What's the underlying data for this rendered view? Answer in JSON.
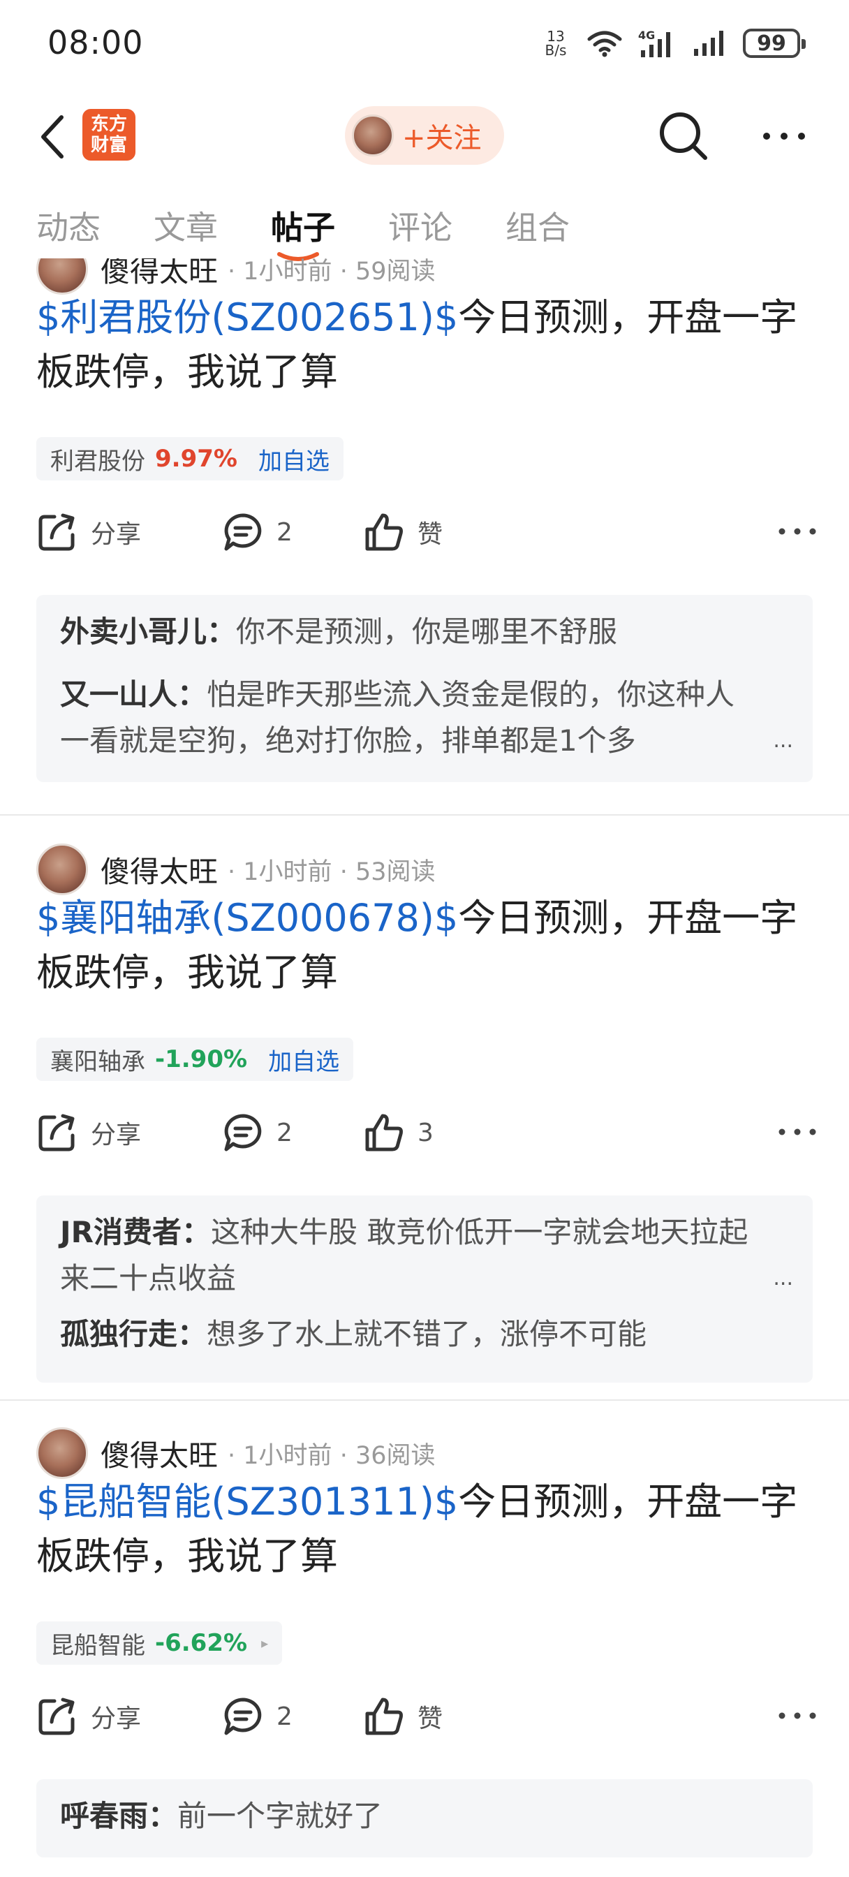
{
  "status_bar": {
    "time": "08:00",
    "net_speed_value": "13",
    "net_speed_unit": "B/s",
    "battery": "99"
  },
  "header": {
    "logo_line1": "东方",
    "logo_line2": "财富",
    "follow_label": "+关注"
  },
  "tabs": [
    {
      "label": "动态"
    },
    {
      "label": "文章"
    },
    {
      "label": "帖子"
    },
    {
      "label": "评论"
    },
    {
      "label": "组合"
    }
  ],
  "active_tab": "帖子",
  "colors": {
    "brand": "#ec5a2a",
    "link": "#1a64c8",
    "up": "#e0452d",
    "down": "#21a35a"
  },
  "posts": [
    {
      "author": "傻得太旺",
      "time": "1小时前",
      "reads": "59阅读",
      "stock_link": "$利君股份(SZ002651)$",
      "title_rest": "今日预测，开盘一字板跌停，我说了算",
      "chip": {
        "name": "利君股份",
        "change": "9.97%",
        "add": "加自选"
      },
      "actions": {
        "share": "分享",
        "comments": "2",
        "like": "赞"
      },
      "comments": [
        {
          "author": "外卖小哥儿：",
          "text": "你不是预测，你是哪里不舒服"
        },
        {
          "author": "又一山人：",
          "text": "怕是昨天那些流入资金是假的，你这种人一看就是空狗，绝对打你脸，排单都是1个多",
          "ellipsis": "..."
        }
      ]
    },
    {
      "author": "傻得太旺",
      "time": "1小时前",
      "reads": "53阅读",
      "stock_link": "$襄阳轴承(SZ000678)$",
      "title_rest": "今日预测，开盘一字板跌停，我说了算",
      "chip": {
        "name": "襄阳轴承",
        "change": "-1.90%",
        "add": "加自选"
      },
      "actions": {
        "share": "分享",
        "comments": "2",
        "like": "3"
      },
      "comments": [
        {
          "author": "JR消费者：",
          "text": "这种大牛股 敢竞价低开一字就会地天拉起来二十点收益",
          "ellipsis": "..."
        },
        {
          "author": "孤独行走：",
          "text": "想多了水上就不错了，涨停不可能"
        }
      ]
    },
    {
      "author": "傻得太旺",
      "time": "1小时前",
      "reads": "36阅读",
      "stock_link": "$昆船智能(SZ301311)$",
      "title_rest": "今日预测，开盘一字板跌停，我说了算",
      "chip": {
        "name": "昆船智能",
        "change": "-6.62%",
        "arrow": "▸"
      },
      "actions": {
        "share": "分享",
        "comments": "2",
        "like": "赞"
      },
      "comments": [
        {
          "author": "呼春雨：",
          "text": "前一个字就好了"
        }
      ]
    }
  ]
}
